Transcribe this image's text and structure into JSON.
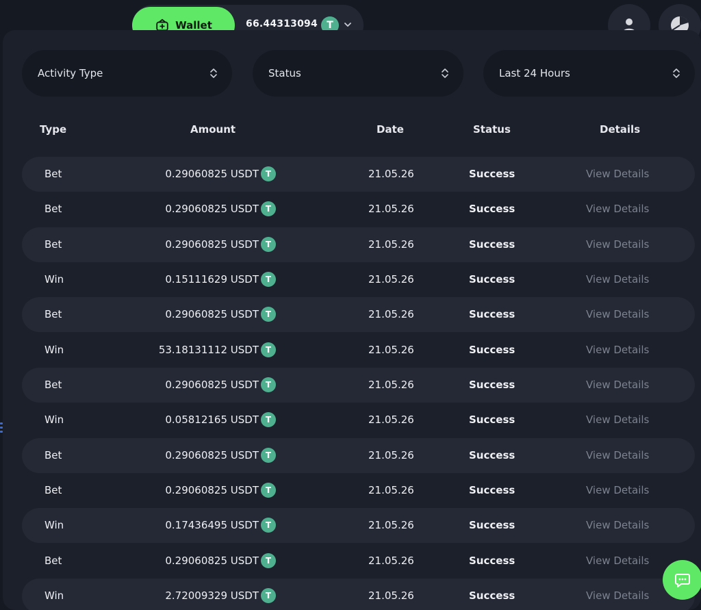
{
  "header": {
    "wallet_label": "Wallet",
    "balance": "66.44313094",
    "currency_icon_glyph": "T"
  },
  "filters": {
    "activity_type": "Activity Type",
    "status": "Status",
    "time_range": "Last 24 Hours"
  },
  "table": {
    "columns": [
      "Type",
      "Amount",
      "Date",
      "Status",
      "Details"
    ],
    "currency": "USDT",
    "coin_glyph": "T",
    "rows": [
      {
        "type": "Bet",
        "amount": "0.29060825 USDT",
        "date": "21.05.26",
        "status": "Success",
        "details": "View Details"
      },
      {
        "type": "Bet",
        "amount": "0.29060825 USDT",
        "date": "21.05.26",
        "status": "Success",
        "details": "View Details"
      },
      {
        "type": "Bet",
        "amount": "0.29060825 USDT",
        "date": "21.05.26",
        "status": "Success",
        "details": "View Details"
      },
      {
        "type": "Win",
        "amount": "0.15111629 USDT",
        "date": "21.05.26",
        "status": "Success",
        "details": "View Details"
      },
      {
        "type": "Bet",
        "amount": "0.29060825 USDT",
        "date": "21.05.26",
        "status": "Success",
        "details": "View Details"
      },
      {
        "type": "Win",
        "amount": "53.18131112 USDT",
        "date": "21.05.26",
        "status": "Success",
        "details": "View Details"
      },
      {
        "type": "Bet",
        "amount": "0.29060825 USDT",
        "date": "21.05.26",
        "status": "Success",
        "details": "View Details"
      },
      {
        "type": "Win",
        "amount": "0.05812165 USDT",
        "date": "21.05.26",
        "status": "Success",
        "details": "View Details"
      },
      {
        "type": "Bet",
        "amount": "0.29060825 USDT",
        "date": "21.05.26",
        "status": "Success",
        "details": "View Details"
      },
      {
        "type": "Bet",
        "amount": "0.29060825 USDT",
        "date": "21.05.26",
        "status": "Success",
        "details": "View Details"
      },
      {
        "type": "Win",
        "amount": "0.17436495 USDT",
        "date": "21.05.26",
        "status": "Success",
        "details": "View Details"
      },
      {
        "type": "Bet",
        "amount": "0.29060825 USDT",
        "date": "21.05.26",
        "status": "Success",
        "details": "View Details"
      },
      {
        "type": "Win",
        "amount": "2.72009329 USDT",
        "date": "21.05.26",
        "status": "Success",
        "details": "View Details"
      }
    ]
  },
  "colors": {
    "accent_green": "#5fe865",
    "coin_teal": "#4fb08f",
    "background": "#151922",
    "panel": "#1c202a",
    "row_shaded": "#242935",
    "muted_text": "#7d8290"
  },
  "icons": [
    "wallet-icon",
    "usdt-coin-icon",
    "chevron-down-icon",
    "user-icon",
    "stats-icon",
    "updown-chevron-icon",
    "chat-icon"
  ]
}
